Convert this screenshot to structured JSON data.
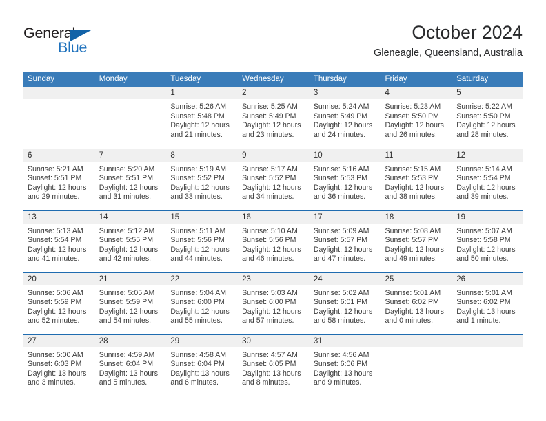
{
  "logo": {
    "word_top": "General",
    "word_bottom": "Blue",
    "triangle_color": "#1263a8",
    "top_color": "#231f20",
    "bottom_color": "#1f72bd"
  },
  "header": {
    "title": "October 2024",
    "subtitle": "Gleneagle, Queensland, Australia"
  },
  "theme": {
    "header_bg": "#3a7cb9",
    "daynum_bg": "#f0f0f0",
    "row_divider": "#1f6cb0",
    "text": "#3b3b3b"
  },
  "weekdays": [
    "Sunday",
    "Monday",
    "Tuesday",
    "Wednesday",
    "Thursday",
    "Friday",
    "Saturday"
  ],
  "weeks": [
    [
      {
        "day": "",
        "sunrise": "",
        "sunset": "",
        "daylight1": "",
        "daylight2": "",
        "empty": true
      },
      {
        "day": "",
        "sunrise": "",
        "sunset": "",
        "daylight1": "",
        "daylight2": "",
        "empty": true
      },
      {
        "day": "1",
        "sunrise": "Sunrise: 5:26 AM",
        "sunset": "Sunset: 5:48 PM",
        "daylight1": "Daylight: 12 hours",
        "daylight2": "and 21 minutes."
      },
      {
        "day": "2",
        "sunrise": "Sunrise: 5:25 AM",
        "sunset": "Sunset: 5:49 PM",
        "daylight1": "Daylight: 12 hours",
        "daylight2": "and 23 minutes."
      },
      {
        "day": "3",
        "sunrise": "Sunrise: 5:24 AM",
        "sunset": "Sunset: 5:49 PM",
        "daylight1": "Daylight: 12 hours",
        "daylight2": "and 24 minutes."
      },
      {
        "day": "4",
        "sunrise": "Sunrise: 5:23 AM",
        "sunset": "Sunset: 5:50 PM",
        "daylight1": "Daylight: 12 hours",
        "daylight2": "and 26 minutes."
      },
      {
        "day": "5",
        "sunrise": "Sunrise: 5:22 AM",
        "sunset": "Sunset: 5:50 PM",
        "daylight1": "Daylight: 12 hours",
        "daylight2": "and 28 minutes."
      }
    ],
    [
      {
        "day": "6",
        "sunrise": "Sunrise: 5:21 AM",
        "sunset": "Sunset: 5:51 PM",
        "daylight1": "Daylight: 12 hours",
        "daylight2": "and 29 minutes."
      },
      {
        "day": "7",
        "sunrise": "Sunrise: 5:20 AM",
        "sunset": "Sunset: 5:51 PM",
        "daylight1": "Daylight: 12 hours",
        "daylight2": "and 31 minutes."
      },
      {
        "day": "8",
        "sunrise": "Sunrise: 5:19 AM",
        "sunset": "Sunset: 5:52 PM",
        "daylight1": "Daylight: 12 hours",
        "daylight2": "and 33 minutes."
      },
      {
        "day": "9",
        "sunrise": "Sunrise: 5:17 AM",
        "sunset": "Sunset: 5:52 PM",
        "daylight1": "Daylight: 12 hours",
        "daylight2": "and 34 minutes."
      },
      {
        "day": "10",
        "sunrise": "Sunrise: 5:16 AM",
        "sunset": "Sunset: 5:53 PM",
        "daylight1": "Daylight: 12 hours",
        "daylight2": "and 36 minutes."
      },
      {
        "day": "11",
        "sunrise": "Sunrise: 5:15 AM",
        "sunset": "Sunset: 5:53 PM",
        "daylight1": "Daylight: 12 hours",
        "daylight2": "and 38 minutes."
      },
      {
        "day": "12",
        "sunrise": "Sunrise: 5:14 AM",
        "sunset": "Sunset: 5:54 PM",
        "daylight1": "Daylight: 12 hours",
        "daylight2": "and 39 minutes."
      }
    ],
    [
      {
        "day": "13",
        "sunrise": "Sunrise: 5:13 AM",
        "sunset": "Sunset: 5:54 PM",
        "daylight1": "Daylight: 12 hours",
        "daylight2": "and 41 minutes."
      },
      {
        "day": "14",
        "sunrise": "Sunrise: 5:12 AM",
        "sunset": "Sunset: 5:55 PM",
        "daylight1": "Daylight: 12 hours",
        "daylight2": "and 42 minutes."
      },
      {
        "day": "15",
        "sunrise": "Sunrise: 5:11 AM",
        "sunset": "Sunset: 5:56 PM",
        "daylight1": "Daylight: 12 hours",
        "daylight2": "and 44 minutes."
      },
      {
        "day": "16",
        "sunrise": "Sunrise: 5:10 AM",
        "sunset": "Sunset: 5:56 PM",
        "daylight1": "Daylight: 12 hours",
        "daylight2": "and 46 minutes."
      },
      {
        "day": "17",
        "sunrise": "Sunrise: 5:09 AM",
        "sunset": "Sunset: 5:57 PM",
        "daylight1": "Daylight: 12 hours",
        "daylight2": "and 47 minutes."
      },
      {
        "day": "18",
        "sunrise": "Sunrise: 5:08 AM",
        "sunset": "Sunset: 5:57 PM",
        "daylight1": "Daylight: 12 hours",
        "daylight2": "and 49 minutes."
      },
      {
        "day": "19",
        "sunrise": "Sunrise: 5:07 AM",
        "sunset": "Sunset: 5:58 PM",
        "daylight1": "Daylight: 12 hours",
        "daylight2": "and 50 minutes."
      }
    ],
    [
      {
        "day": "20",
        "sunrise": "Sunrise: 5:06 AM",
        "sunset": "Sunset: 5:59 PM",
        "daylight1": "Daylight: 12 hours",
        "daylight2": "and 52 minutes."
      },
      {
        "day": "21",
        "sunrise": "Sunrise: 5:05 AM",
        "sunset": "Sunset: 5:59 PM",
        "daylight1": "Daylight: 12 hours",
        "daylight2": "and 54 minutes."
      },
      {
        "day": "22",
        "sunrise": "Sunrise: 5:04 AM",
        "sunset": "Sunset: 6:00 PM",
        "daylight1": "Daylight: 12 hours",
        "daylight2": "and 55 minutes."
      },
      {
        "day": "23",
        "sunrise": "Sunrise: 5:03 AM",
        "sunset": "Sunset: 6:00 PM",
        "daylight1": "Daylight: 12 hours",
        "daylight2": "and 57 minutes."
      },
      {
        "day": "24",
        "sunrise": "Sunrise: 5:02 AM",
        "sunset": "Sunset: 6:01 PM",
        "daylight1": "Daylight: 12 hours",
        "daylight2": "and 58 minutes."
      },
      {
        "day": "25",
        "sunrise": "Sunrise: 5:01 AM",
        "sunset": "Sunset: 6:02 PM",
        "daylight1": "Daylight: 13 hours",
        "daylight2": "and 0 minutes."
      },
      {
        "day": "26",
        "sunrise": "Sunrise: 5:01 AM",
        "sunset": "Sunset: 6:02 PM",
        "daylight1": "Daylight: 13 hours",
        "daylight2": "and 1 minute."
      }
    ],
    [
      {
        "day": "27",
        "sunrise": "Sunrise: 5:00 AM",
        "sunset": "Sunset: 6:03 PM",
        "daylight1": "Daylight: 13 hours",
        "daylight2": "and 3 minutes."
      },
      {
        "day": "28",
        "sunrise": "Sunrise: 4:59 AM",
        "sunset": "Sunset: 6:04 PM",
        "daylight1": "Daylight: 13 hours",
        "daylight2": "and 5 minutes."
      },
      {
        "day": "29",
        "sunrise": "Sunrise: 4:58 AM",
        "sunset": "Sunset: 6:04 PM",
        "daylight1": "Daylight: 13 hours",
        "daylight2": "and 6 minutes."
      },
      {
        "day": "30",
        "sunrise": "Sunrise: 4:57 AM",
        "sunset": "Sunset: 6:05 PM",
        "daylight1": "Daylight: 13 hours",
        "daylight2": "and 8 minutes."
      },
      {
        "day": "31",
        "sunrise": "Sunrise: 4:56 AM",
        "sunset": "Sunset: 6:06 PM",
        "daylight1": "Daylight: 13 hours",
        "daylight2": "and 9 minutes."
      },
      {
        "day": "",
        "sunrise": "",
        "sunset": "",
        "daylight1": "",
        "daylight2": "",
        "empty": true
      },
      {
        "day": "",
        "sunrise": "",
        "sunset": "",
        "daylight1": "",
        "daylight2": "",
        "empty": true
      }
    ]
  ]
}
